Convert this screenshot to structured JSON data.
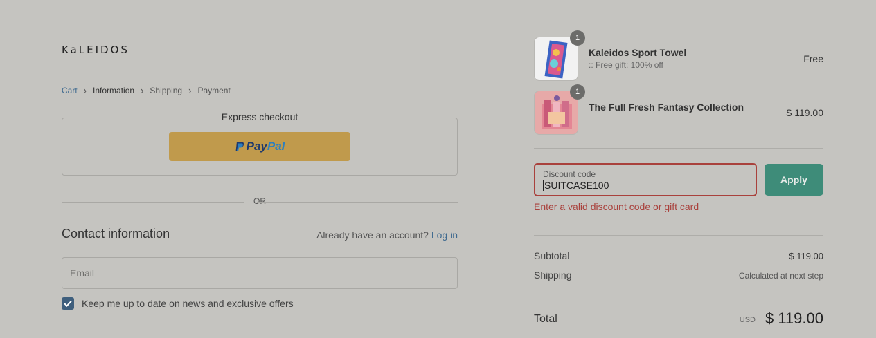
{
  "brand": {
    "logo_text": "KaLEIDOS"
  },
  "breadcrumb": {
    "items": [
      "Cart",
      "Information",
      "Shipping",
      "Payment"
    ]
  },
  "express": {
    "title": "Express checkout",
    "paypal_pay": "Pay",
    "paypal_pal": "Pal"
  },
  "divider_or": "OR",
  "contact": {
    "title": "Contact information",
    "account_prompt": "Already have an account?",
    "login_link": "Log in",
    "email_placeholder": "Email",
    "newsletter_label": "Keep me up to date on news and exclusive offers",
    "newsletter_checked": true
  },
  "cart": {
    "items": [
      {
        "name": "Kaleidos Sport Towel",
        "subtitle": ":: Free gift: 100% off",
        "price": "Free",
        "quantity": "1",
        "icon": "towel-product-image"
      },
      {
        "name": "The Full Fresh Fantasy Collection",
        "subtitle": "",
        "price": "$ 119.00",
        "quantity": "1",
        "icon": "collection-product-image"
      }
    ]
  },
  "discount": {
    "label": "Discount code",
    "value": "SUITCASE100",
    "apply_label": "Apply",
    "error": "Enter a valid discount code or gift card"
  },
  "summary": {
    "subtotal_label": "Subtotal",
    "subtotal_value": "$ 119.00",
    "shipping_label": "Shipping",
    "shipping_value": "Calculated at next step",
    "total_label": "Total",
    "total_currency": "USD",
    "total_value": "$ 119.00"
  },
  "colors": {
    "background": "#c5c4c0",
    "link": "#3f6a8f",
    "paypal_button": "#c09a4c",
    "apply_button": "#3e8c79",
    "error": "#a9413c"
  }
}
